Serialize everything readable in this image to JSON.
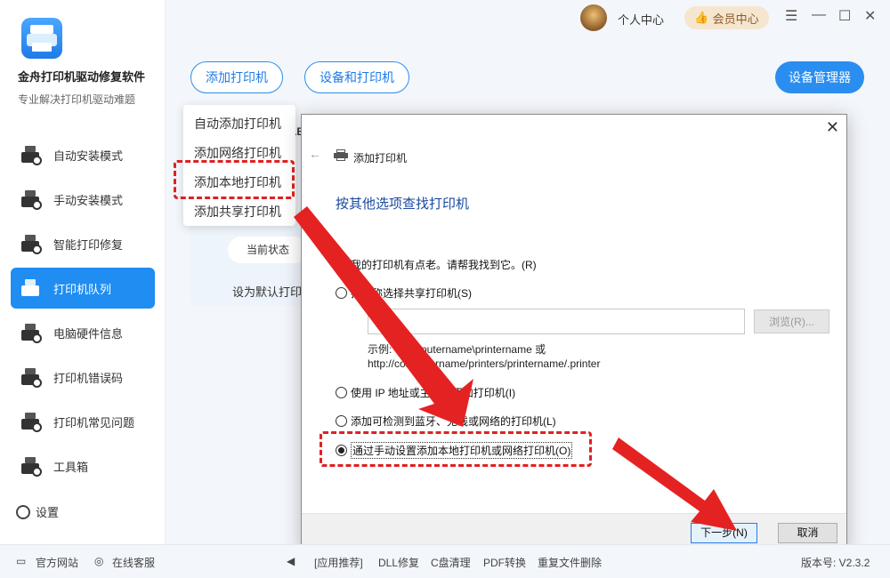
{
  "app": {
    "title": "金舟打印机驱动修复软件",
    "subtitle": "专业解决打印机驱动难题"
  },
  "sidebar": {
    "items": [
      {
        "label": "自动安装模式"
      },
      {
        "label": "手动安装模式"
      },
      {
        "label": "智能打印修复"
      },
      {
        "label": "打印机队列"
      },
      {
        "label": "电脑硬件信息"
      },
      {
        "label": "打印机错误码"
      },
      {
        "label": "打印机常见问题"
      },
      {
        "label": "工具箱"
      }
    ],
    "active_index": 3,
    "settings_label": "设置"
  },
  "topbar": {
    "user_center": "个人中心",
    "vip_label": "会员中心",
    "menu_glyph": "☰",
    "minimize_glyph": "—",
    "maximize_glyph": "☐",
    "close_glyph": "✕"
  },
  "toolbar": {
    "add_printer": "添加打印机",
    "devices_printers": "设备和打印机",
    "device_manager": "设备管理器"
  },
  "dropdown": {
    "items": [
      "自动添加打印机",
      "添加网络打印机",
      "添加本地打印机",
      "添加共享打印机"
    ],
    "highlighted_index": 2
  },
  "background": {
    "current_state": "当前状态",
    "set_default": "设为默认打印",
    "partial_text": "LB"
  },
  "dialog": {
    "close_glyph": "✕",
    "back_glyph": "←",
    "title": "添加打印机",
    "heading": "按其他选项查找打印机",
    "options": [
      "我的打印机有点老。请帮我找到它。(R)",
      "按名称选择共享打印机(S)",
      "使用 IP 地址或主机名添加打印机(I)",
      "添加可检测到蓝牙、无线或网络的打印机(L)",
      "通过手动设置添加本地打印机或网络打印机(O)"
    ],
    "selected_index": 4,
    "share_input_value": "",
    "browse_label": "浏览(R)...",
    "example_line1": "示例: \\\\computername\\printername 或",
    "example_line2": "http://computername/printers/printername/.printer",
    "next_label": "下一步(N)",
    "cancel_label": "取消"
  },
  "footer": {
    "website": "官方网站",
    "online_service": "在线客服",
    "recommend": "[应用推荐]",
    "dll_repair": "DLL修复",
    "c_clean": "C盘清理",
    "pdf_convert": "PDF转换",
    "dup_delete": "重复文件删除",
    "version": "版本号: V2.3.2"
  },
  "colors": {
    "accent": "#2a8ef0",
    "highlight_red": "#e02020",
    "vip_bg": "#f6e6cf"
  }
}
